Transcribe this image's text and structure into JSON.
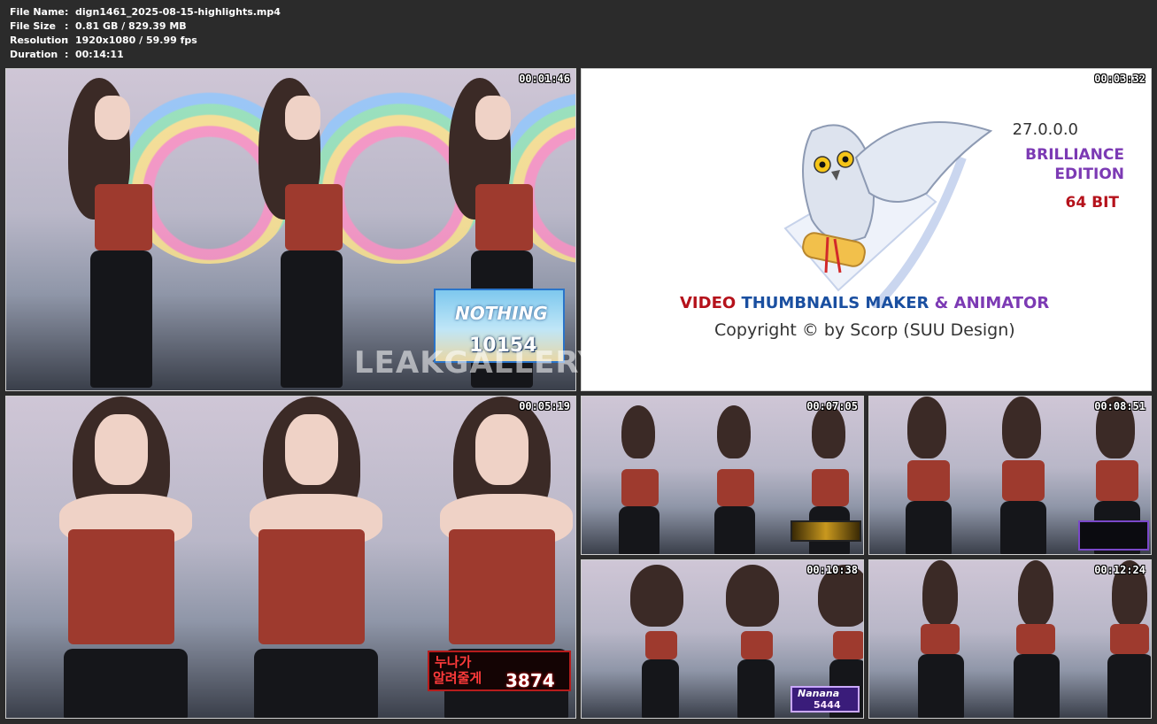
{
  "meta": {
    "rows": [
      {
        "key": "File Name",
        "value": "dign1461_2025-08-15-highlights.mp4"
      },
      {
        "key": "File Size",
        "value": "0.81 GB / 829.39 MB"
      },
      {
        "key": "Resolution",
        "value": "1920x1080 / 59.99 fps"
      },
      {
        "key": "Duration",
        "value": "00:14:11"
      }
    ],
    "separator": ":"
  },
  "frames": [
    {
      "timestamp": "00:01:46"
    },
    {
      "timestamp": "00:03:32"
    },
    {
      "timestamp": "00:05:19"
    },
    {
      "timestamp": "00:07:05"
    },
    {
      "timestamp": "00:08:51"
    },
    {
      "timestamp": "00:10:38"
    },
    {
      "timestamp": "00:12:24"
    }
  ],
  "logo": {
    "version": "27.0.0.0",
    "edition_line1": "BRILLIANCE",
    "edition_line2": "EDITION",
    "bits": "64 BIT",
    "title_word1": "VIDEO",
    "title_word2": "THUMBNAILS MAKER",
    "title_word3": "& ANIMATOR",
    "copyright": "Copyright © by Scorp (SUU Design)"
  },
  "overlays": {
    "nothing_title": "NOTHING",
    "nothing_count": "10154",
    "korean_line1": "누나가",
    "korean_line2": "알려줄게",
    "korean_count": "3874",
    "nanana": "Nanana",
    "nanana_count": "5444"
  },
  "watermark": "LEAKGALLERY.COM",
  "colors": {
    "background": "#2b2b2b",
    "video_red": "#b5121b",
    "thumbnails_blue": "#1a4fa0",
    "animator_purple": "#7c3ab4"
  }
}
